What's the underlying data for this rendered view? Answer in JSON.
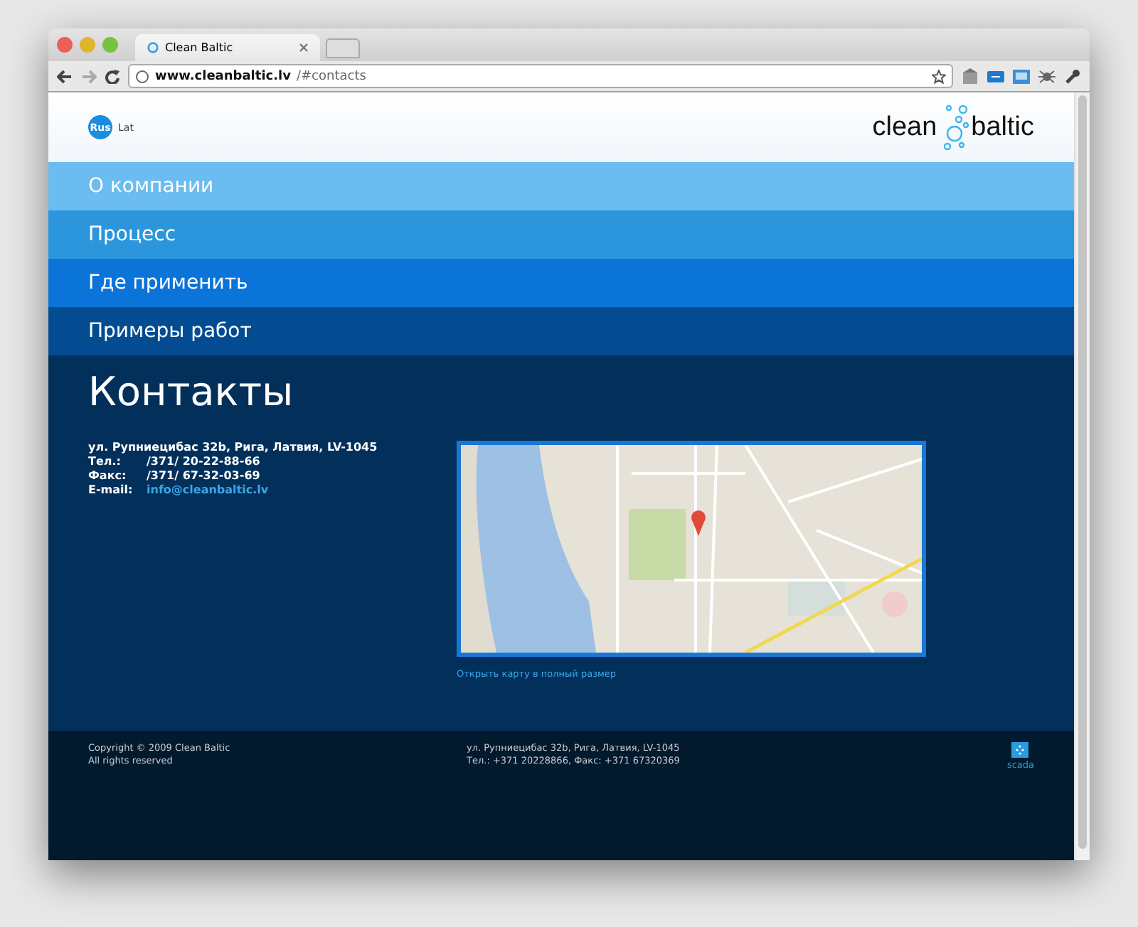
{
  "browser": {
    "tab_title": "Clean Baltic",
    "url_host": "www.cleanbaltic.lv",
    "url_path": "/#contacts"
  },
  "languages": [
    {
      "label": "Rus",
      "selected": true
    },
    {
      "label": "Lat",
      "selected": false
    }
  ],
  "logo": {
    "word_1": "clean",
    "word_2": "baltic"
  },
  "nav": [
    {
      "label": "О компании",
      "color": "#6bbcf0"
    },
    {
      "label": "Процесс",
      "color": "#2b96dc"
    },
    {
      "label": "Где применить",
      "color": "#0b74d8"
    },
    {
      "label": "Примеры работ",
      "color": "#034c92"
    }
  ],
  "contacts": {
    "title": "Контакты",
    "address": "ул. Рупниецибас 32b, Рига, Латвия, LV-1045",
    "rows": [
      {
        "label": "Тел.:",
        "value": "/371/ 20-22-88-66",
        "kind": "text"
      },
      {
        "label": "Факс:",
        "value": "/371/ 67-32-03-69",
        "kind": "text"
      },
      {
        "label": "E-mail:",
        "value": "info@cleanbaltic.lv",
        "kind": "link"
      }
    ],
    "map_link": "Открыть карту в полный размер"
  },
  "footer": {
    "copyright": "Copyright © 2009 Clean Baltic",
    "rights": "All rights reserved",
    "address": "ул. Рупниецибас 32b, Рига, Латвия, LV-1045",
    "phones": "Тел.: +371 20228866, Факс: +371 67320369",
    "badge": "scada"
  }
}
